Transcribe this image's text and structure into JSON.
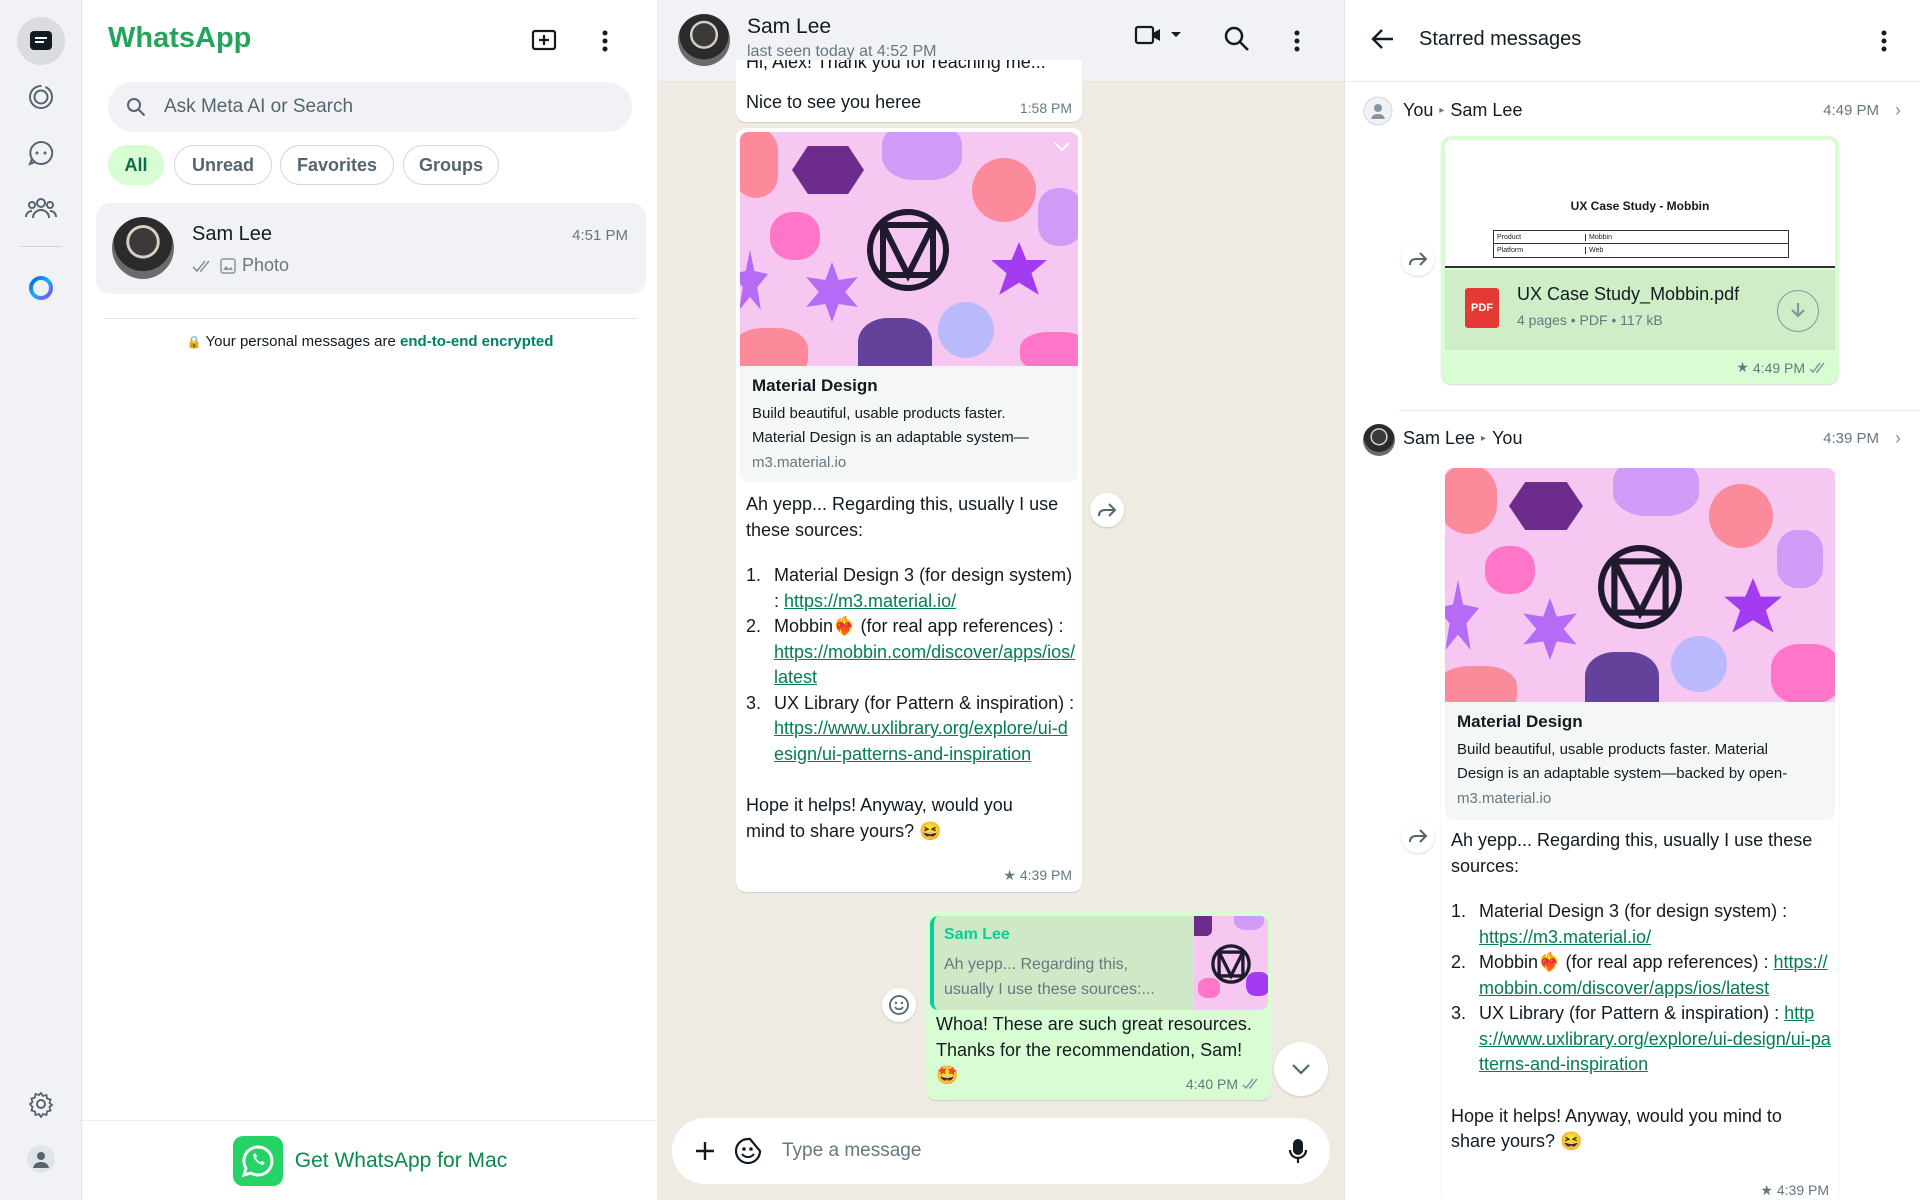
{
  "app": {
    "brand": "WhatsApp"
  },
  "search": {
    "placeholder": "Ask Meta AI or Search"
  },
  "filters": [
    "All",
    "Unread",
    "Favorites",
    "Groups"
  ],
  "chats": [
    {
      "name": "Sam Lee",
      "time": "4:51 PM",
      "preview": "Photo"
    }
  ],
  "encryption": {
    "prefix": "Your personal messages are ",
    "link": "end-to-end encrypted"
  },
  "get_app": "Get WhatsApp for Mac",
  "conversation": {
    "contact": "Sam Lee",
    "status": "last seen today at 4:52 PM",
    "top_msg": {
      "partial": "Hi, Alex! Thank you for reaching me...",
      "text": "Nice to see you heree",
      "time": "1:58 PM"
    },
    "link_preview": {
      "title": "Material Design",
      "desc1": "Build beautiful, usable products faster.",
      "desc2": "Material Design is an adaptable system—",
      "url": "m3.material.io"
    },
    "msg": {
      "intro": "Ah yepp... Regarding this, usually I use these sources:",
      "items": [
        {
          "n": "1.",
          "text": "Material Design 3 (for design system) : ",
          "link": "https://m3.material.io/"
        },
        {
          "n": "2.",
          "text": "Mobbin❤️‍🔥 (for real app references) : ",
          "link": "https://mobbin.com/discover/apps/ios/latest"
        },
        {
          "n": "3.",
          "text": "UX Library (for Pattern & inspiration) : ",
          "link": "https://www.uxlibrary.org/explore/ui-design/ui-patterns-and-inspiration"
        }
      ],
      "outro": "Hope it helps! Anyway, would you mind to share yours? 😆",
      "time": "4:39 PM"
    },
    "reply": {
      "quoted_name": "Sam Lee",
      "quoted_text": "Ah yepp... Regarding this, usually I use these sources:...",
      "text": "Whoa! These are such great resources. Thanks for the recommendation, Sam! 🤩",
      "time": "4:40 PM"
    },
    "composer_placeholder": "Type a message"
  },
  "starred": {
    "title": "Starred messages",
    "item1": {
      "from": "You",
      "to": "Sam Lee",
      "time": "4:49 PM",
      "doc_title": "UX Case Study - Mobbin",
      "table": [
        [
          "Product",
          "Mobbin"
        ],
        [
          "Platform",
          "Web"
        ]
      ],
      "file": "UX Case Study_Mobbin.pdf",
      "file_meta": "4 pages • PDF • 117 kB",
      "pdf": "PDF",
      "msg_time": "4:49 PM"
    },
    "item2": {
      "from": "Sam Lee",
      "to": "You",
      "time": "4:39 PM",
      "lp_title": "Material Design",
      "lp_desc": "Build beautiful, usable products faster. Material Design is an adaptable system—backed by open-",
      "lp_url": "m3.material.io",
      "msg_time": "4:39 PM"
    }
  },
  "colors": {
    "brand": "#25a35a",
    "outgoing": "#d9fdd3",
    "chat_bg": "#efeae2",
    "link": "#027e4f"
  }
}
